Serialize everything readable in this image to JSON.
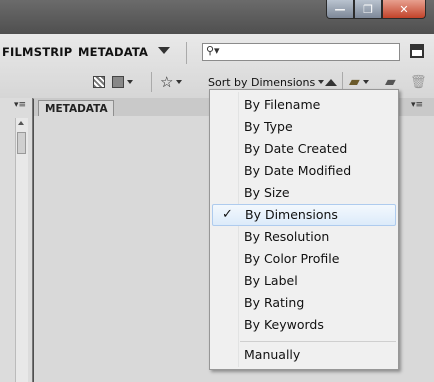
{
  "window": {
    "buttons": [
      {
        "name": "minimize",
        "glyph": "—"
      },
      {
        "name": "restore",
        "glyph": "❐"
      },
      {
        "name": "close",
        "glyph": "✕"
      }
    ]
  },
  "toolbar": {
    "workspaces": [
      "FILMSTRIP",
      "METADATA"
    ],
    "search_placeholder": "",
    "sort_label": "Sort by Dimensions",
    "icons": [
      "quality-preview-icon",
      "thumbnail-quality-icon",
      "star-rating-filter-icon",
      "open-recent-folder-icon",
      "new-folder-icon",
      "delete-icon"
    ]
  },
  "panels": {
    "metadata_tab": "METADATA"
  },
  "sort_menu": {
    "selected": "By Dimensions",
    "items": [
      "By Filename",
      "By Type",
      "By Date Created",
      "By Date Modified",
      "By Size",
      "By Dimensions",
      "By Resolution",
      "By Color Profile",
      "By Label",
      "By Rating",
      "By Keywords"
    ],
    "manual": "Manually",
    "check_glyph": "✓"
  },
  "colors": {
    "menu_bg": "#f0f0f0",
    "selection_bg": "#dcebfa",
    "selection_border": "#aecbee",
    "close_red": "#c2432a"
  }
}
